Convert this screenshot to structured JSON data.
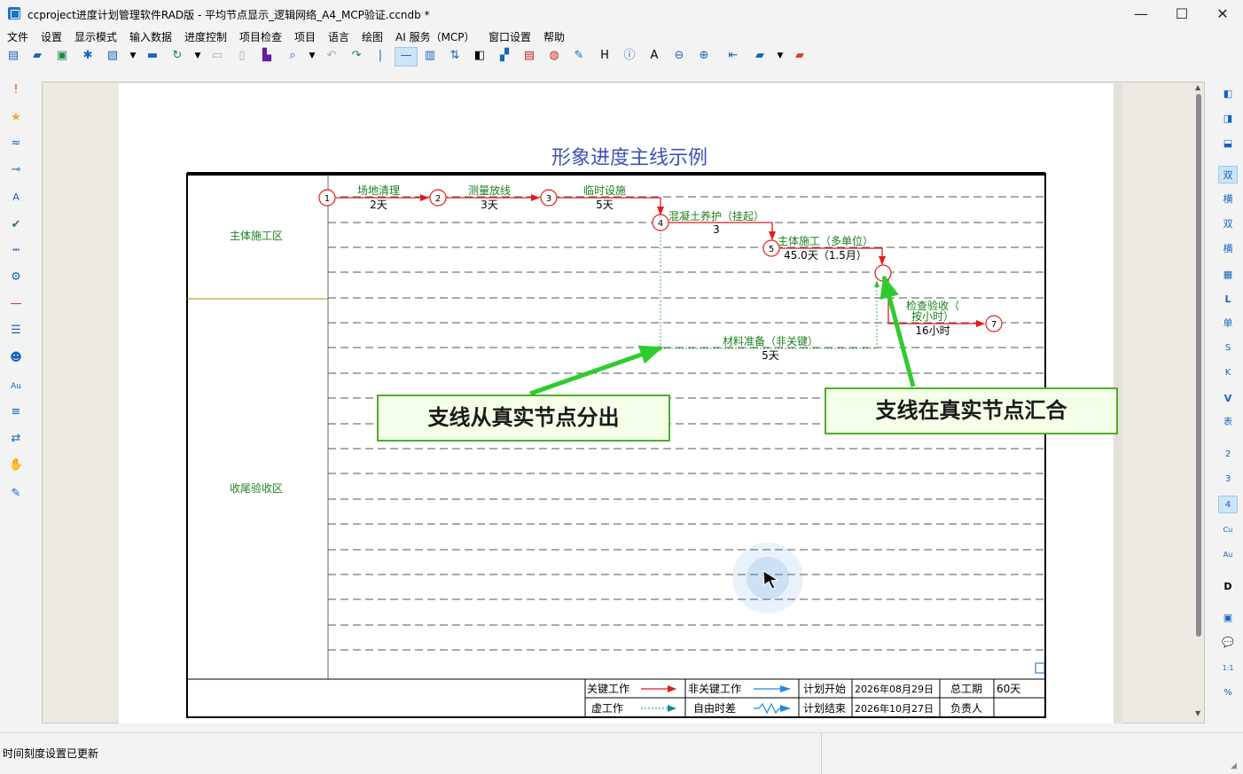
{
  "window": {
    "title": "ccproject进度计划管理软件RAD版 - 平均节点显示_逻辑网络_A4_MCP验证.ccndb *",
    "minimize": "—",
    "maximize": "☐",
    "close": "✕"
  },
  "menu": [
    "文件",
    "设置",
    "显示模式",
    "输入数据",
    "进度控制",
    "项目检查",
    "项目",
    "语言",
    "绘图",
    "AI 服务（MCP）",
    "窗口设置",
    "帮助"
  ],
  "right_toolbar": [
    "双",
    "横",
    "双",
    "横",
    "L",
    "单",
    "S",
    "K",
    "V",
    "表",
    "2",
    "3",
    "4",
    "Cu",
    "Au",
    "D",
    "1:1",
    "%"
  ],
  "chart": {
    "title": "形象进度主线示例",
    "zones": [
      "主体施工区",
      "收尾验收区"
    ],
    "nodes": [
      "1",
      "2",
      "3",
      "4",
      "5",
      "7"
    ],
    "activities": [
      {
        "name": "场地清理",
        "duration": "2天"
      },
      {
        "name": "测量放线",
        "duration": "3天"
      },
      {
        "name": "临时设施",
        "duration": "5天"
      },
      {
        "name": "混凝土养护（挂起）",
        "duration": "3"
      },
      {
        "name": "主体施工（多单位）",
        "duration": "45.0天（1.5月）"
      },
      {
        "name": "检查验收（",
        "name2": "按小时）",
        "duration": "16小时"
      },
      {
        "name": "材料准备（非关键）",
        "duration": "5天"
      }
    ],
    "legend": {
      "critical": "关键工作",
      "noncritical": "非关键工作",
      "dummy": "虚工作",
      "float": "自由时差",
      "plan_start_label": "计划开始",
      "plan_start": "2026年08月29日",
      "plan_end_label": "计划结束",
      "plan_end": "2026年10月27日",
      "total_label": "总工期",
      "total": "60天",
      "owner_label": "负责人"
    }
  },
  "annotations": {
    "left": "支线从真实节点分出",
    "right": "支线在真实节点汇合"
  },
  "status": {
    "text": "时间刻度设置已更新"
  },
  "colors": {
    "critical": "#e41a1a",
    "noncritical": "#1e88e5",
    "label": "#1a7f1a",
    "title": "#3f51b5",
    "annotation": "#2ecc2e"
  }
}
